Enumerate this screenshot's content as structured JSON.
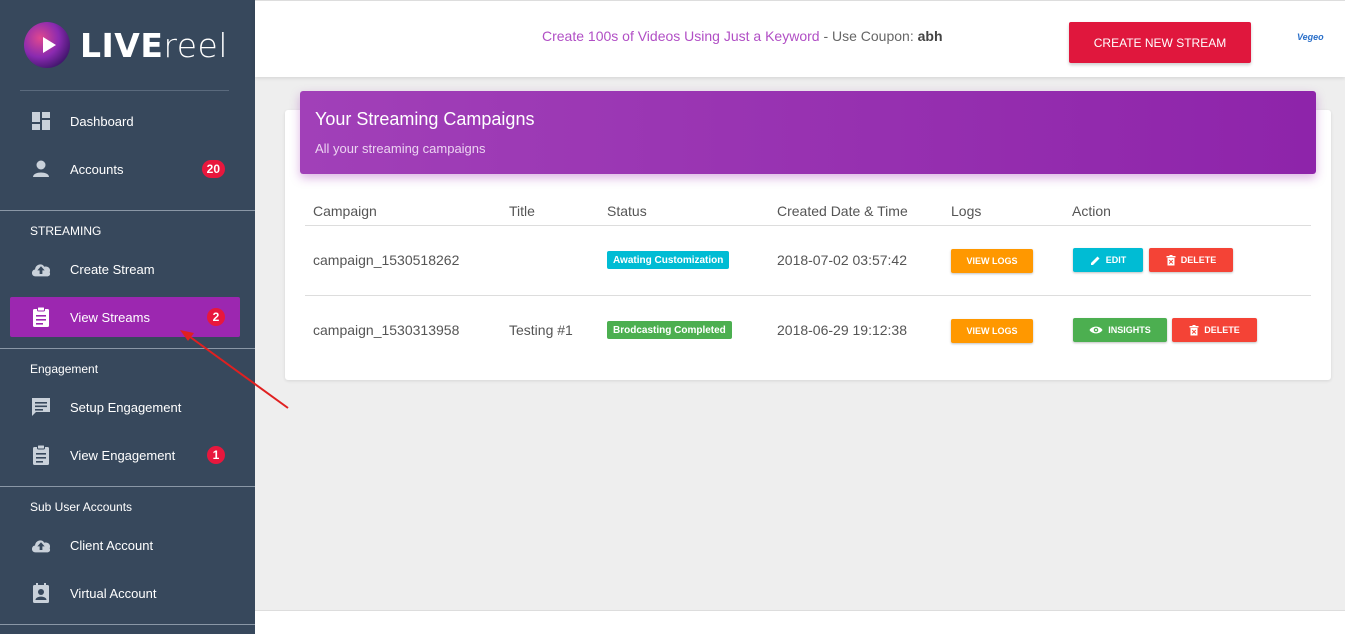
{
  "brand": {
    "name_bold": "LIVE",
    "name_light": "reel",
    "small_logo": "Vegeo"
  },
  "sidebar": {
    "items": [
      {
        "label": "Dashboard",
        "icon": "dashboard-icon"
      },
      {
        "label": "Accounts",
        "icon": "person-icon",
        "badge": "20"
      }
    ],
    "sections": [
      {
        "title": "STREAMING",
        "items": [
          {
            "label": "Create Stream",
            "icon": "cloud-upload-icon"
          },
          {
            "label": "View Streams",
            "icon": "clipboard-icon",
            "badge": "2",
            "active": true
          }
        ]
      },
      {
        "title": "Engagement",
        "items": [
          {
            "label": "Setup Engagement",
            "icon": "comment-icon"
          },
          {
            "label": "View Engagement",
            "icon": "clipboard-icon",
            "badge": "1"
          }
        ]
      },
      {
        "title": "Sub User Accounts",
        "items": [
          {
            "label": "Client Account",
            "icon": "cloud-upload-icon"
          },
          {
            "label": "Virtual Account",
            "icon": "contact-icon"
          }
        ]
      }
    ]
  },
  "header": {
    "promo_link": "Create 100s of Videos Using Just a Keyword",
    "promo_text": " - Use Coupon: ",
    "coupon": "abh",
    "create_button": "CREATE NEW STREAM"
  },
  "card": {
    "title": "Your Streaming Campaigns",
    "subtitle": "All your streaming campaigns",
    "columns": [
      "Campaign",
      "Title",
      "Status",
      "Created Date & Time",
      "Logs",
      "Action"
    ],
    "rows": [
      {
        "campaign": "campaign_1530518262",
        "title": "",
        "status": "Awating Customization",
        "status_color": "#00bcd4",
        "created": "2018-07-02 03:57:42",
        "logs_label": "VIEW LOGS",
        "action1": "EDIT",
        "action1_color": "#00bcd4",
        "action2": "DELETE"
      },
      {
        "campaign": "campaign_1530313958",
        "title": "Testing #1",
        "status": "Brodcasting Completed",
        "status_color": "#4caf50",
        "created": "2018-06-29 19:12:38",
        "logs_label": "VIEW LOGS",
        "action1": "INSIGHTS",
        "action1_color": "#4caf50",
        "action2": "DELETE"
      }
    ]
  },
  "colors": {
    "accent": "#9c27b0",
    "danger": "#f44336",
    "warning": "#ff9800",
    "sidebar": "#37485c"
  }
}
